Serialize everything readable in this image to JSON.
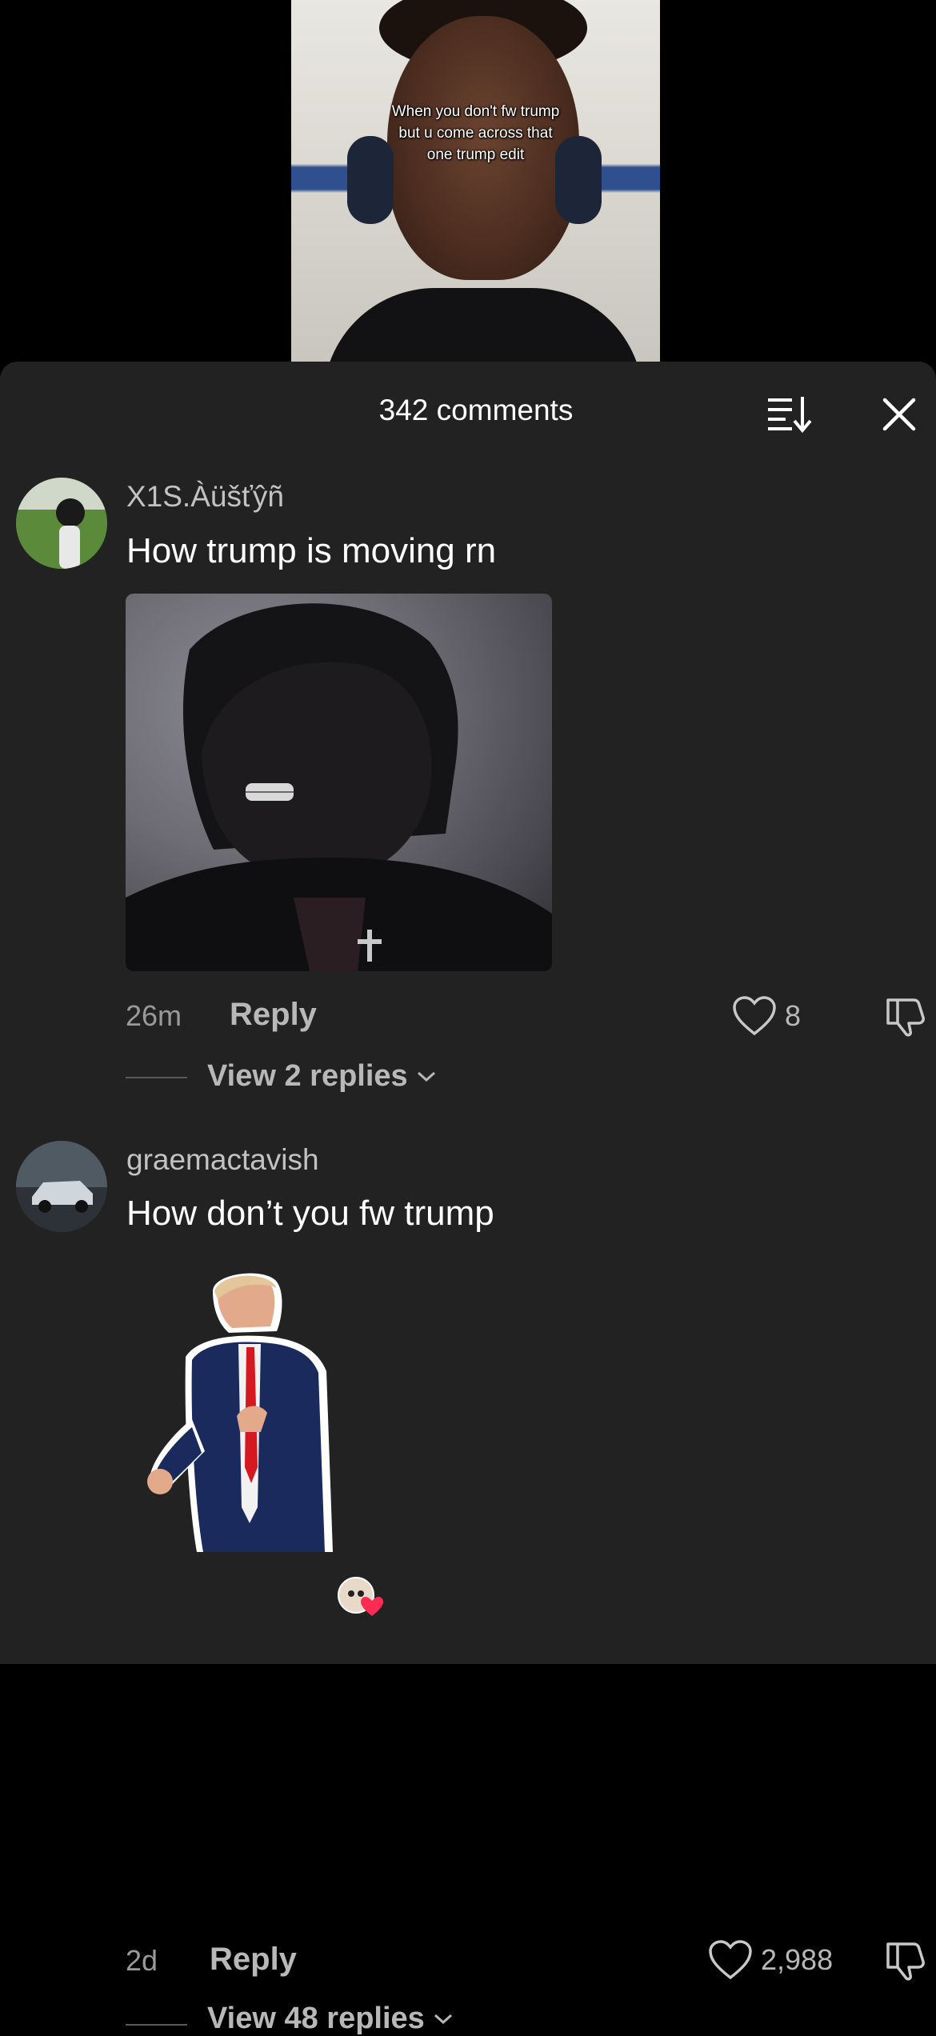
{
  "video": {
    "caption_lines": [
      "When you don't fw trump",
      "but u come across that",
      "one trump edit"
    ]
  },
  "header": {
    "comments_count": "342 comments",
    "sort_icon": "sort-icon",
    "close_icon": "close-icon"
  },
  "comments": [
    {
      "username": "X1S.Àüšťŷñ",
      "text": "How trump is moving rn",
      "media": "dark-edited-trump-photo",
      "time": "26m",
      "reply_label": "Reply",
      "likes": "8",
      "view_replies": "View 2 replies"
    },
    {
      "username": "graemactavish",
      "text": "How don’t you fw trump",
      "media": "trump-dancing-sticker",
      "time": "2d",
      "reply_label": "Reply",
      "likes": "2,988",
      "view_replies": "View 48 replies"
    }
  ],
  "colors": {
    "sheet_bg": "#222222",
    "text_primary": "#ffffff",
    "text_secondary": "#b8b8b8",
    "like_reaction": "#fe2c55"
  }
}
